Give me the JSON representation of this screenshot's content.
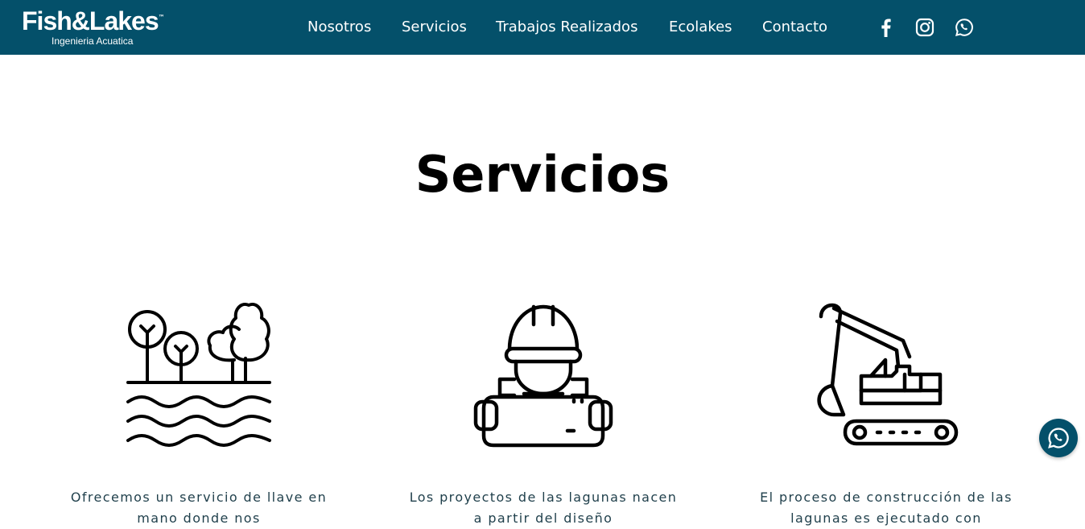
{
  "brand": {
    "name": "Fish&Lakes",
    "tm": "™",
    "tagline": "Ingenieria Acuatica"
  },
  "nav": {
    "items": [
      "Nosotros",
      "Servicios",
      "Trabajos Realizados",
      "Ecolakes",
      "Contacto"
    ]
  },
  "social": [
    "facebook-icon",
    "instagram-icon",
    "whatsapp-icon"
  ],
  "colors": {
    "header_bg": "#04506a",
    "text_dark": "#1f3f4b",
    "title": "#000000"
  },
  "page": {
    "title": "Servicios"
  },
  "services": [
    {
      "icon": "trees-lake-icon",
      "text": "Ofrecemos un servicio de llave en mano donde nos"
    },
    {
      "icon": "engineer-with-plans-icon",
      "text": "Los proyectos de las lagunas nacen a partir del diseño"
    },
    {
      "icon": "excavator-icon",
      "text": "El proceso de construcción de las lagunas es ejecutado con"
    }
  ],
  "floating": {
    "icon": "whatsapp-icon"
  }
}
